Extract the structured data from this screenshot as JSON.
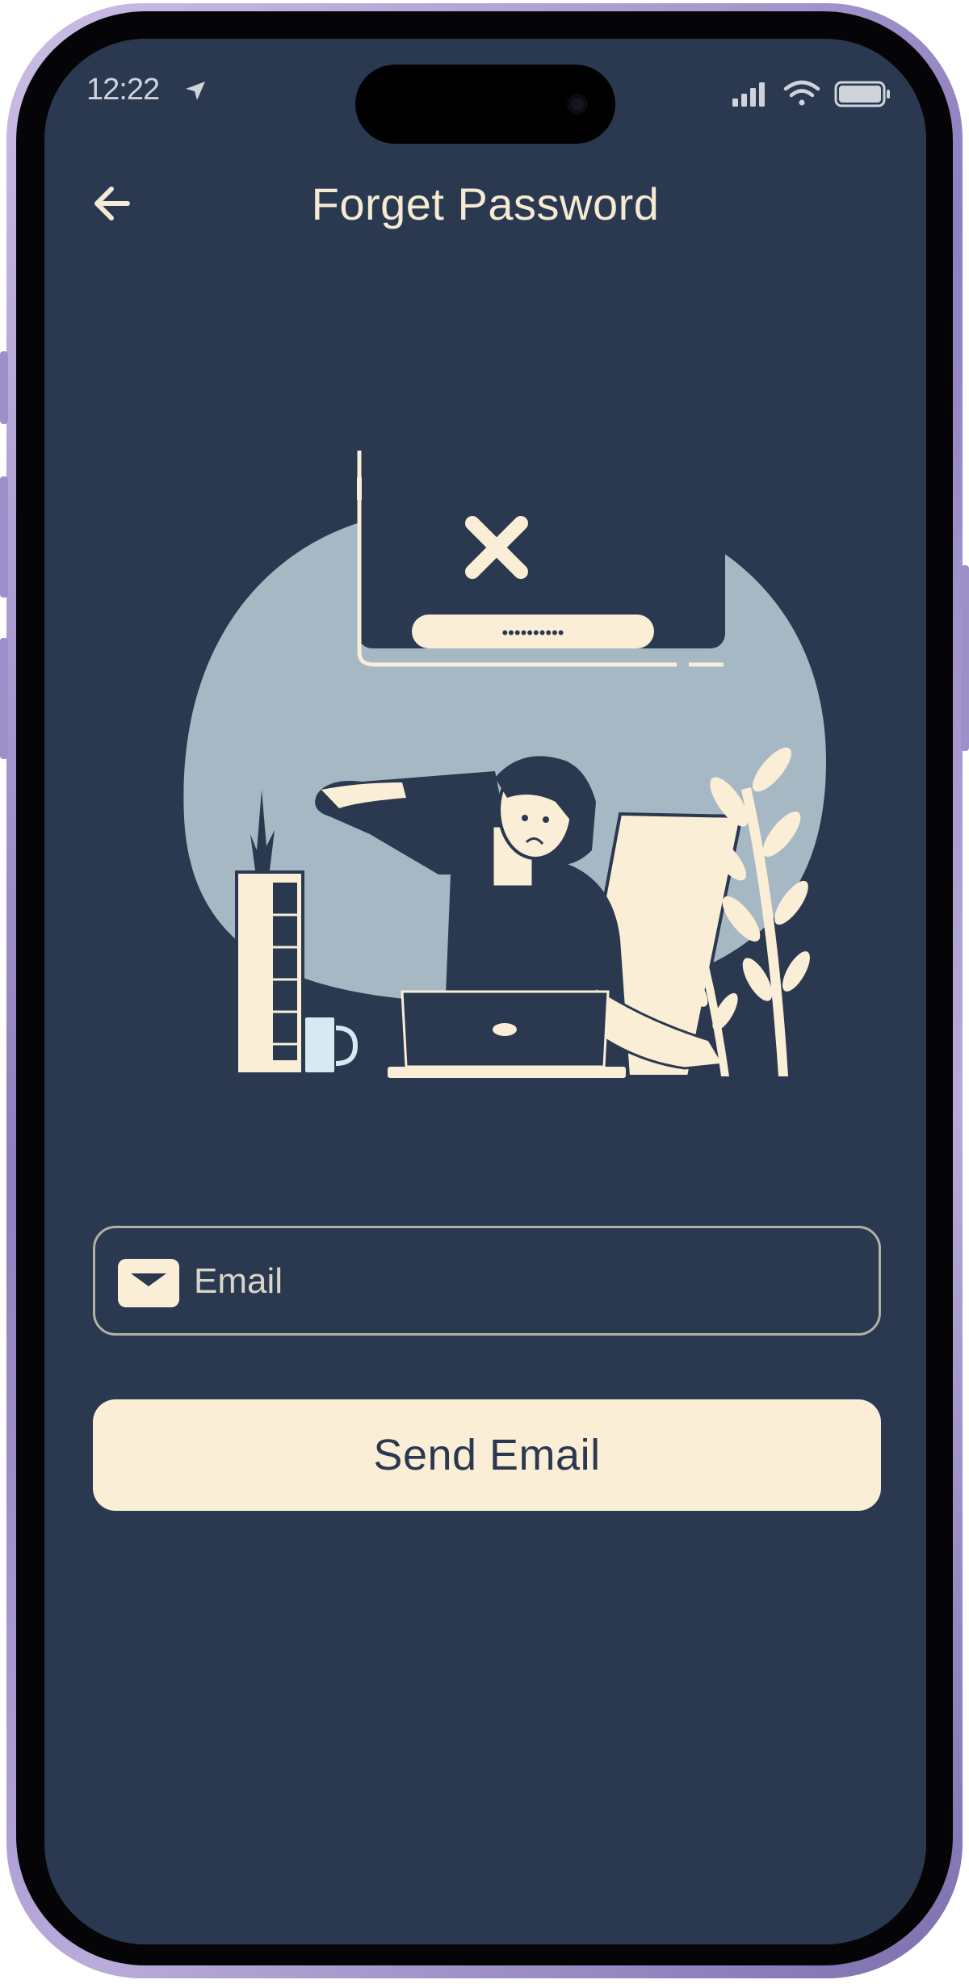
{
  "status_bar": {
    "time": "12:22",
    "icons": [
      "location-arrow-icon",
      "cellular-signal-icon",
      "wifi-icon",
      "battery-icon"
    ]
  },
  "header": {
    "back_icon": "arrow-left-icon",
    "title": "Forget Password"
  },
  "illustration": {
    "popup_icon": "close-x-icon",
    "password_mask": "••••••••••"
  },
  "email_field": {
    "icon": "envelope-icon",
    "placeholder": "Email",
    "value": ""
  },
  "send_button": {
    "label": "Send Email"
  },
  "colors": {
    "background": "#2a3850",
    "accent": "#fbeed6",
    "illustration_circle": "#a6b8c4",
    "title_text": "#f5ead2",
    "frame": "#9d8fc9"
  }
}
